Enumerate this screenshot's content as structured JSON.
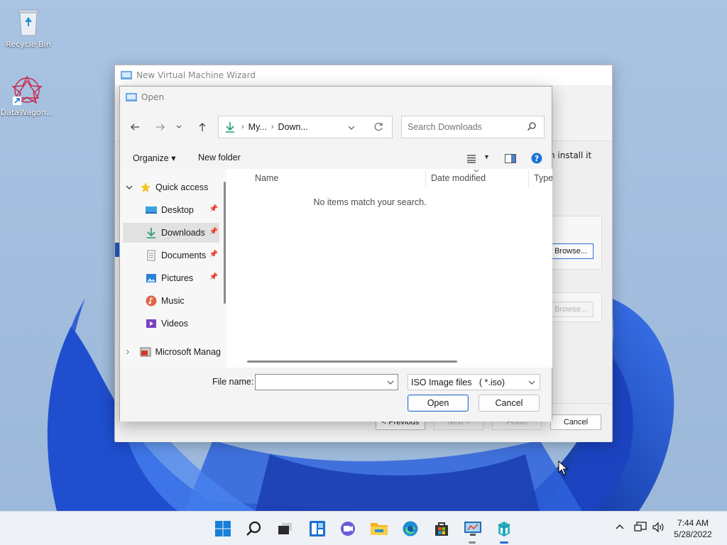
{
  "desktop": {
    "icons": [
      {
        "label": "Recycle Bin",
        "icon": "recycle-bin-icon"
      },
      {
        "label": "DataWagon...",
        "icon": "datawagon-icon"
      }
    ]
  },
  "wizard": {
    "title": "New Virtual Machine Wizard",
    "partial_text": "n install it",
    "browse_label_1": "Browse...",
    "browse_label_2": "Browse...",
    "previous_label": "< Previous",
    "next_label": "Next >",
    "finish_label": "Finish",
    "cancel_label": "Cancel"
  },
  "open_dialog": {
    "title": "Open",
    "address": {
      "segments": [
        "My...",
        "Down..."
      ]
    },
    "search": {
      "placeholder": "Search Downloads"
    },
    "toolbar": {
      "organize": "Organize",
      "new_folder": "New folder"
    },
    "nav_pane": {
      "quick_access": "Quick access",
      "items": [
        {
          "label": "Desktop",
          "icon": "desktop-folder-icon",
          "pinned": true
        },
        {
          "label": "Downloads",
          "icon": "downloads-folder-icon",
          "pinned": true,
          "selected": true
        },
        {
          "label": "Documents",
          "icon": "documents-folder-icon",
          "pinned": true
        },
        {
          "label": "Pictures",
          "icon": "pictures-folder-icon",
          "pinned": true
        },
        {
          "label": "Music",
          "icon": "music-folder-icon",
          "pinned": false
        },
        {
          "label": "Videos",
          "icon": "videos-folder-icon",
          "pinned": false
        }
      ],
      "microsoft": "Microsoft Manag"
    },
    "columns": [
      "Name",
      "Date modified",
      "Type"
    ],
    "empty_message": "No items match your search.",
    "file_name_label": "File name:",
    "file_name_value": "",
    "file_type": "ISO Image files   ( *.iso)",
    "open_label": "Open",
    "cancel_label": "Cancel"
  },
  "taskbar": {
    "icons": [
      "start-icon",
      "search-icon",
      "task-view-icon",
      "widgets-icon",
      "chat-icon",
      "file-explorer-icon",
      "edge-icon",
      "store-icon",
      "vm-app-icon",
      "datawagon-taskbar-icon"
    ],
    "time": "7:44 AM",
    "date": "5/28/2022"
  },
  "colors": {
    "accent": "#2a6fd1",
    "taskbar": "#eef1f5"
  }
}
